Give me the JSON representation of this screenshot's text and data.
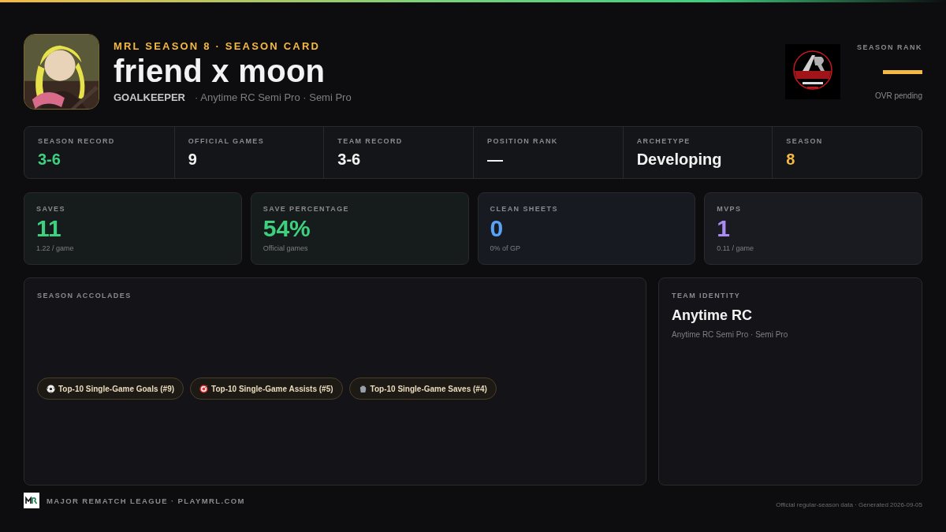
{
  "header": {
    "eyebrow": "MRL SEASON 8 · SEASON CARD",
    "player_name": "friend x moon",
    "position": "GOALKEEPER",
    "team_line": "· Anytime RC Semi Pro · Semi Pro"
  },
  "season_rank": {
    "label": "SEASON RANK",
    "note": "OVR pending"
  },
  "summary": [
    {
      "label": "SEASON RECORD",
      "value": "3-6",
      "color": "#3ecf7f"
    },
    {
      "label": "OFFICIAL GAMES",
      "value": "9",
      "color": "#f2f2f2"
    },
    {
      "label": "TEAM RECORD",
      "value": "3-6",
      "color": "#f2f2f2"
    },
    {
      "label": "POSITION RANK",
      "value": "—",
      "color": "#f2f2f2"
    },
    {
      "label": "ARCHETYPE",
      "value": "Developing",
      "color": "#f2f2f2"
    },
    {
      "label": "SEASON",
      "value": "8",
      "color": "#f5b942"
    }
  ],
  "metrics": [
    {
      "label": "SAVES",
      "value": "11",
      "sub": "1.22 / game",
      "color": "#3ecf7f"
    },
    {
      "label": "SAVE PERCENTAGE",
      "value": "54%",
      "sub": "Official games",
      "color": "#3ecf7f"
    },
    {
      "label": "CLEAN SHEETS",
      "value": "0",
      "sub": "0% of GP",
      "color": "#5aa2f5"
    },
    {
      "label": "MVPS",
      "value": "1",
      "sub": "0.11 / game",
      "color": "#a98bf2"
    }
  ],
  "accolades": {
    "title": "SEASON ACCOLADES",
    "items": [
      {
        "kind": "ball",
        "text": "Top-10 Single-Game Goals (#9)"
      },
      {
        "kind": "target",
        "text": "Top-10 Single-Game Assists (#5)"
      },
      {
        "kind": "glove",
        "text": "Top-10 Single-Game Saves (#4)"
      }
    ]
  },
  "team_identity": {
    "title": "TEAM IDENTITY",
    "name": "Anytime RC",
    "sub": "Anytime RC Semi Pro · Semi Pro"
  },
  "footer": {
    "brand": "MAJOR REMATCH LEAGUE · PLAYMRL.COM",
    "note": "Official regular-season data · Generated 2026-09-05"
  }
}
